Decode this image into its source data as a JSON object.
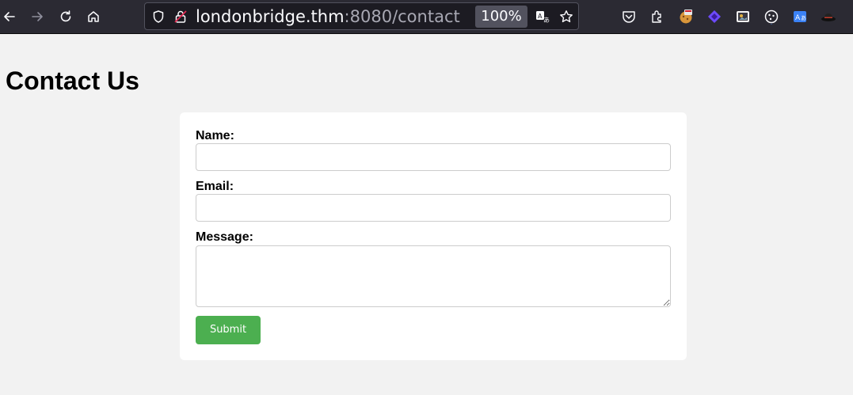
{
  "browser": {
    "url_host": "londonbridge.thm",
    "url_rest": ":8080/contact",
    "zoom": "100%",
    "extensions": [
      "pocket-icon",
      "extensions-icon",
      "cookie-extension-icon",
      "proton-extension-icon",
      "card-extension-icon",
      "cookie-editor-icon",
      "translate-extension-icon",
      "hat-extension-icon"
    ]
  },
  "page": {
    "title": "Contact Us"
  },
  "form": {
    "name_label": "Name:",
    "name_value": "",
    "email_label": "Email:",
    "email_value": "",
    "message_label": "Message:",
    "message_value": "",
    "submit_label": "Submit"
  },
  "colors": {
    "page_background": "#f2f2f2",
    "card_background": "#ffffff",
    "submit_button": "#4caf50",
    "toolbar": "#2b2a33"
  }
}
